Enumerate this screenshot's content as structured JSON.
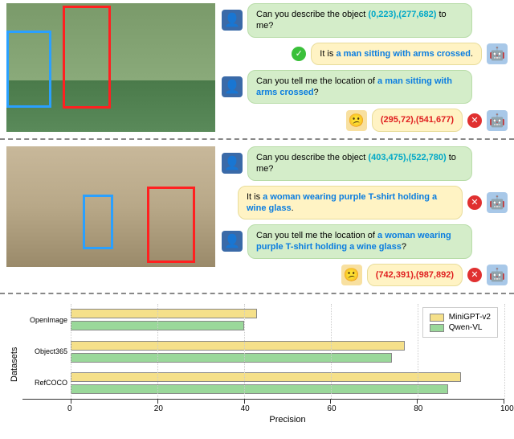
{
  "example1": {
    "q1_prefix": "Can you describe the object ",
    "q1_coords": "(0,223),(277,682)",
    "q1_suffix": " to me?",
    "a1_prefix": "It is ",
    "a1_hl": "a man sitting with arms crossed",
    "a1_suffix": ".",
    "q2_prefix": "Can you tell me the location of ",
    "q2_hl": "a man sitting with arms crossed",
    "q2_suffix": "?",
    "a2": "(295,72),(541,677)"
  },
  "example2": {
    "q1_prefix": "Can you describe the object ",
    "q1_coords": "(403,475),(522,780)",
    "q1_suffix": " to me?",
    "a1_prefix": "It is ",
    "a1_hl": "a woman wearing purple T-shirt holding a wine glass",
    "a1_suffix": ".",
    "q2_prefix": "Can you tell me the location of ",
    "q2_hl": "a woman wearing purple T-shirt holding a wine glass",
    "q2_suffix": "?",
    "a2": "(742,391),(987,892)"
  },
  "chart_data": {
    "type": "bar",
    "orientation": "horizontal",
    "categories": [
      "OpenImage",
      "Object365",
      "RefCOCO"
    ],
    "series": [
      {
        "name": "MiniGPT-v2",
        "color": "#f5e08a",
        "values": [
          43,
          77,
          90
        ]
      },
      {
        "name": "Qwen-VL",
        "color": "#9ad89a",
        "values": [
          40,
          74,
          87
        ]
      }
    ],
    "xlabel": "Precision",
    "ylabel": "Datasets",
    "xlim": [
      0,
      100
    ],
    "xticks": [
      0,
      20,
      40,
      60,
      80,
      100
    ]
  },
  "legend": {
    "s0": "MiniGPT-v2",
    "s1": "Qwen-VL"
  },
  "axis": {
    "ylabel": "Datasets",
    "xlabel": "Precision",
    "y0": "OpenImage",
    "y1": "Object365",
    "y2": "RefCOCO",
    "x0": "0",
    "x1": "20",
    "x2": "40",
    "x3": "60",
    "x4": "80",
    "x5": "100"
  }
}
